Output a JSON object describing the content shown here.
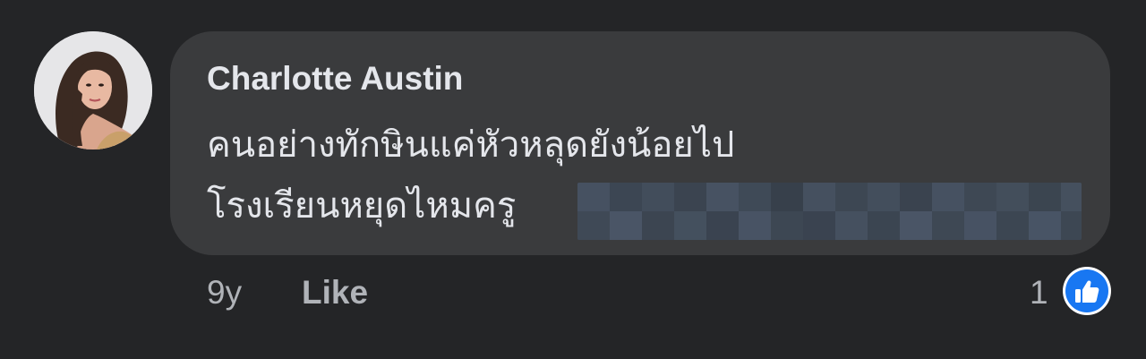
{
  "comment": {
    "author": "Charlotte Austin",
    "lines": [
      "คนอย่างทักษินแค่หัวหลุดยังน้อยไป",
      "โรงเรียนหยุดไหมครู"
    ],
    "redacted": true,
    "timestamp": "9y",
    "like_label": "Like",
    "reaction_count": "1",
    "reaction_icon": "thumbs-up-icon"
  },
  "colors": {
    "background": "#242527",
    "bubble": "#3a3b3d",
    "primary_text": "#e4e6eb",
    "secondary_text": "#b0b3b8",
    "like_blue": "#1877f2",
    "redaction_tint": "#3f4a58"
  }
}
